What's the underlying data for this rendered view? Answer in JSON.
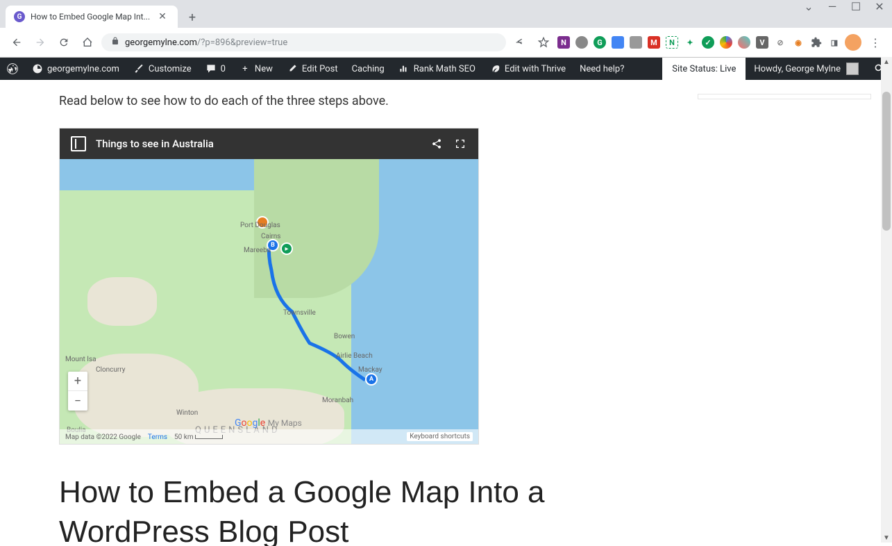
{
  "browser": {
    "tab_title": "How to Embed Google Map Int...",
    "url_domain": "georgemylne.com",
    "url_path": "/?p=896&preview=true"
  },
  "wp_bar": {
    "site_name": "georgemylne.com",
    "customize": "Customize",
    "comments": "0",
    "new": "New",
    "edit_post": "Edit Post",
    "caching": "Caching",
    "rank_math": "Rank Math SEO",
    "thrive": "Edit with Thrive",
    "help": "Need help?",
    "site_status": "Site Status: Live",
    "howdy": "Howdy, George Mylne"
  },
  "article": {
    "intro": "Read below to see how to do each of the three steps above.",
    "heading": "How to Embed a Google Map Into a WordPress Blog Post"
  },
  "map": {
    "title": "Things to see in Australia",
    "labels": {
      "port_douglas": "Port Douglas",
      "cairns": "Cairns",
      "mareeba": "Mareeba",
      "townsville": "Townsville",
      "bowen": "Bowen",
      "airlie": "Airlie Beach",
      "mackay": "Mackay",
      "moranbah": "Moranbah",
      "mount_isa": "Mount Isa",
      "cloncurry": "Cloncurry",
      "winton": "Winton",
      "boulia": "Boulia",
      "queensland": "QUEENSLAND"
    },
    "attribution": "Map data ©2022 Google",
    "terms": "Terms",
    "scale": "50 km",
    "shortcuts": "Keyboard shortcuts",
    "logo_my": "My Maps",
    "logo_g": "Google"
  }
}
